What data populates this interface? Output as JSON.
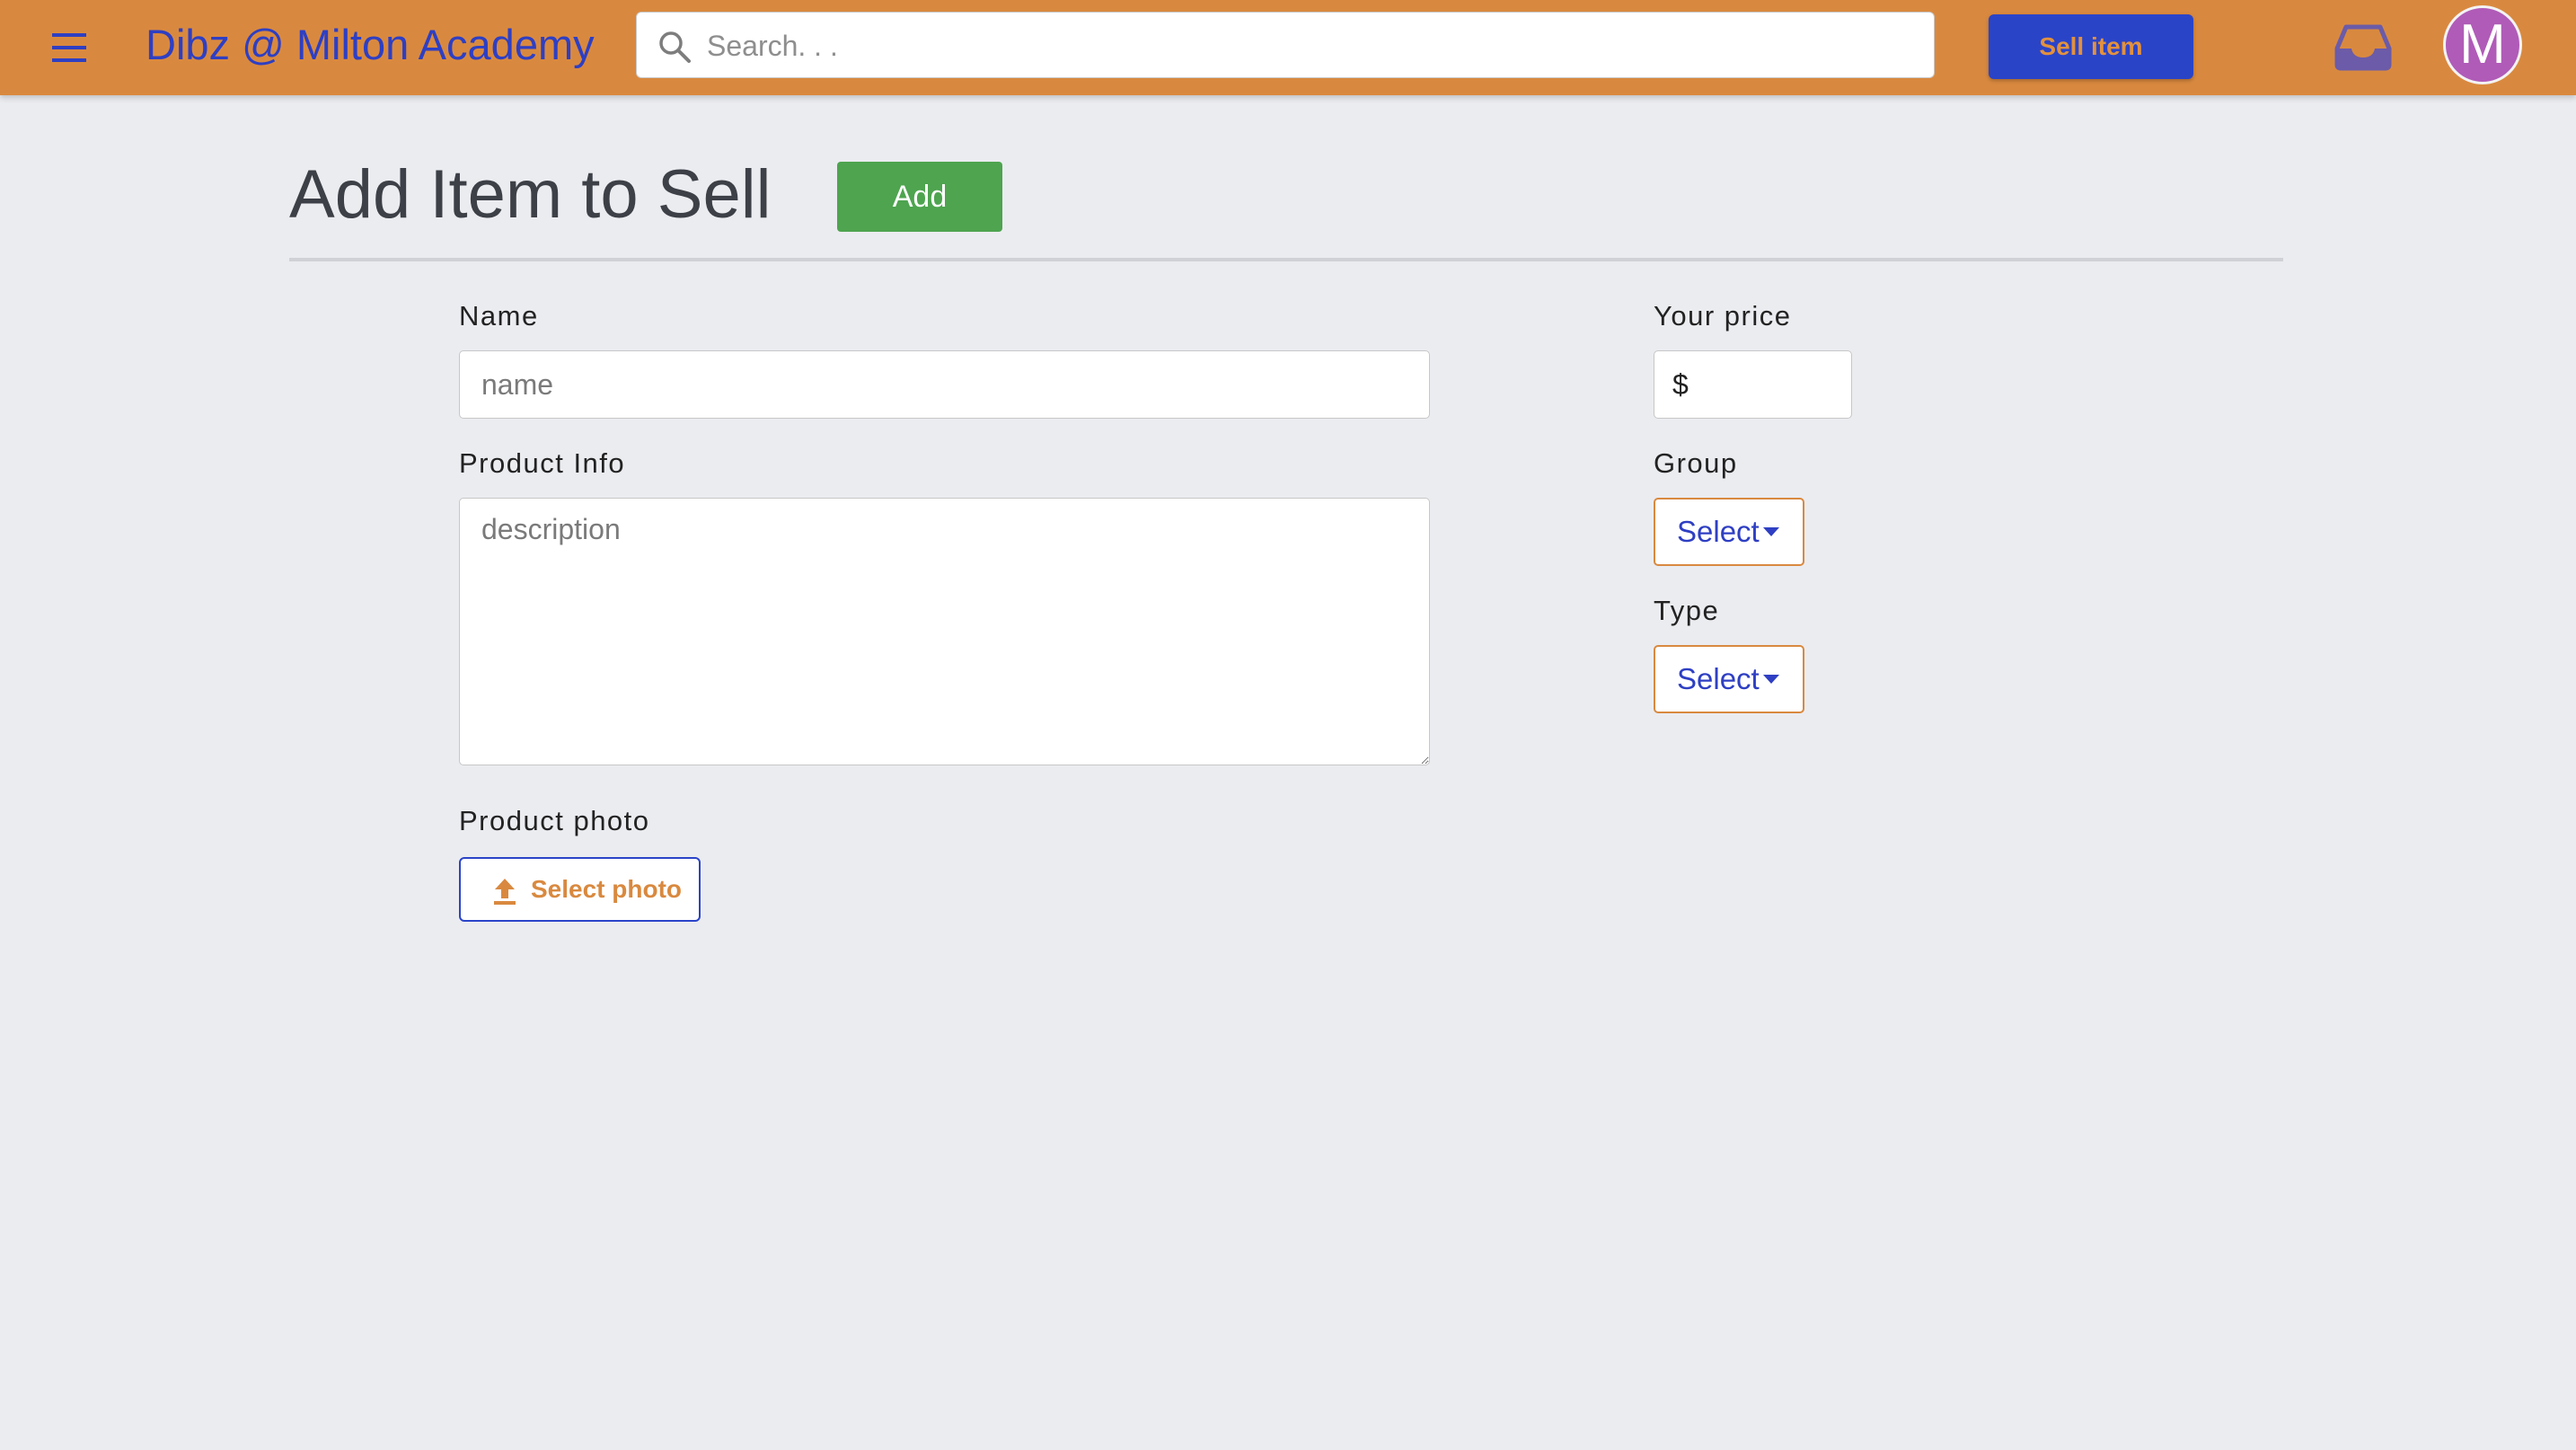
{
  "app": {
    "brand": "Dibz @ Milton Academy",
    "colors": {
      "topbar": "#d9893f",
      "brand_text": "#2e3fc3",
      "primary": "#2a44c8",
      "success": "#4ea44f",
      "avatar": "#b05bb8",
      "background": "#ebecf0"
    }
  },
  "topbar": {
    "menu_icon": "hamburger-menu-icon",
    "search": {
      "placeholder": "Search. . .",
      "value": "",
      "icon": "search-icon"
    },
    "sell_label": "Sell item",
    "inbox_icon": "inbox-tray-icon",
    "avatar_initial": "M"
  },
  "page": {
    "title": "Add Item to Sell",
    "add_label": "Add"
  },
  "form": {
    "name": {
      "label": "Name",
      "placeholder": "name",
      "value": ""
    },
    "product_info": {
      "label": "Product Info",
      "placeholder": "description",
      "value": ""
    },
    "product_photo": {
      "label": "Product photo",
      "button_label": "Select photo",
      "icon": "upload-icon"
    },
    "price": {
      "label": "Your price",
      "currency_symbol": "$",
      "value": ""
    },
    "group": {
      "label": "Group",
      "selected": "Select"
    },
    "type": {
      "label": "Type",
      "selected": "Select"
    }
  }
}
